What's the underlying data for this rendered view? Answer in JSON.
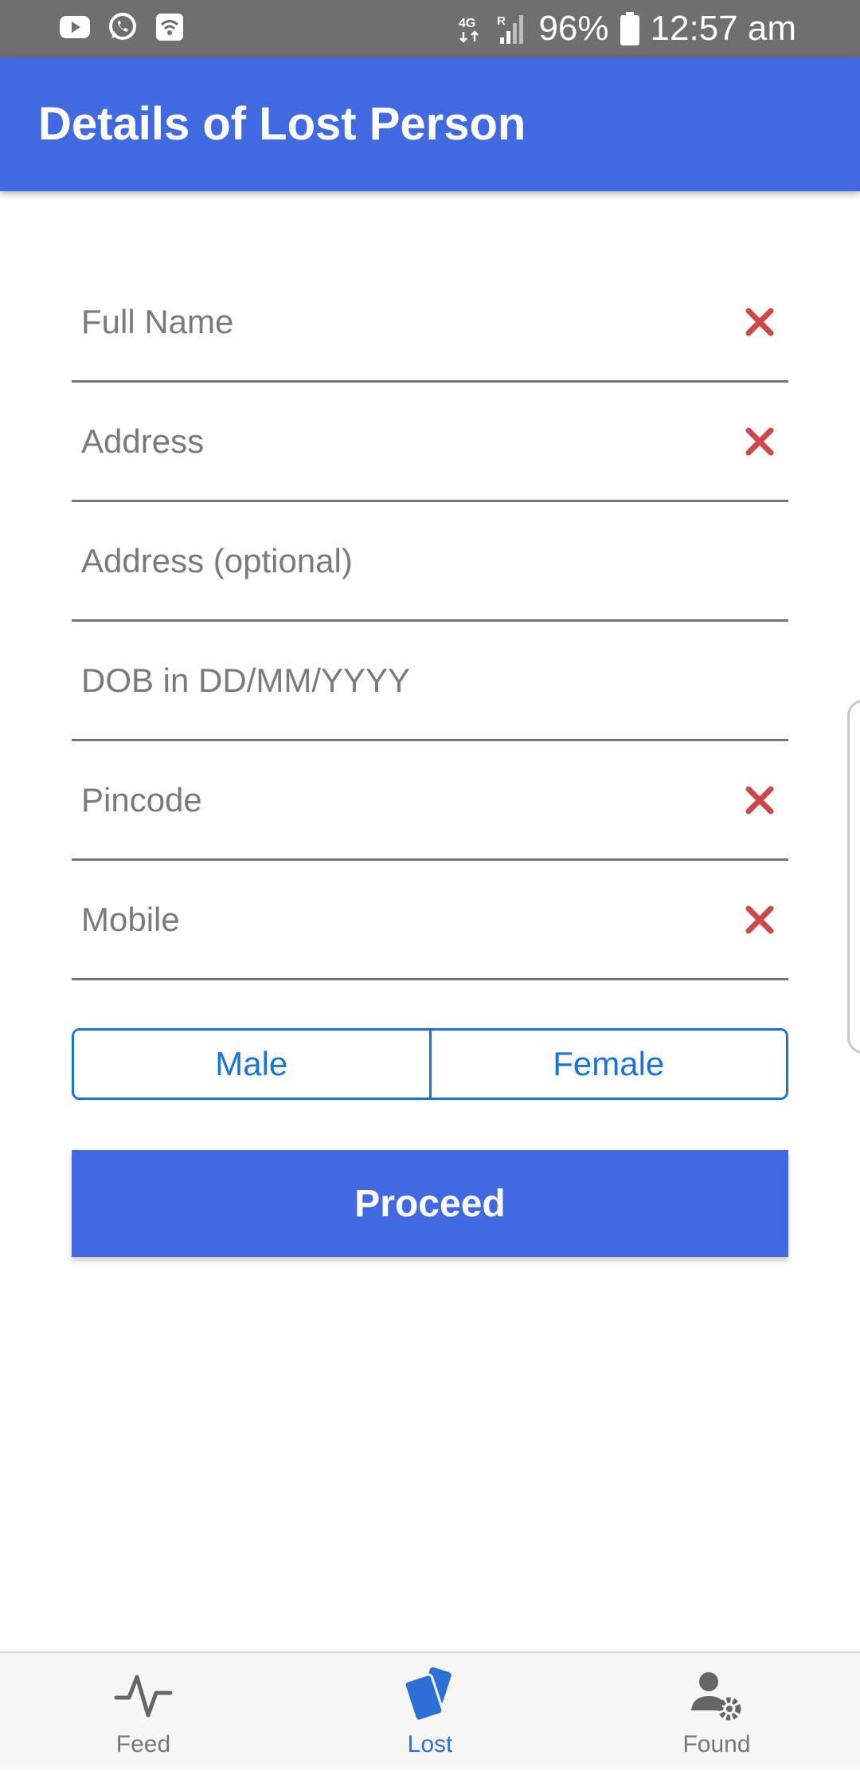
{
  "status_bar": {
    "battery_percent": "96%",
    "time": "12:57 am",
    "network": "4G",
    "roaming": "R",
    "left_icons": [
      "youtube-icon",
      "whatsapp-icon",
      "wifi-calling-icon"
    ]
  },
  "app_bar": {
    "title": "Details of Lost Person"
  },
  "form": {
    "fields": [
      {
        "placeholder": "Full Name",
        "value": "",
        "has_error": true
      },
      {
        "placeholder": "Address",
        "value": "",
        "has_error": true
      },
      {
        "placeholder": "Address (optional)",
        "value": "",
        "has_error": false
      },
      {
        "placeholder": "DOB in DD/MM/YYYY",
        "value": "",
        "has_error": false
      },
      {
        "placeholder": "Pincode",
        "value": "",
        "has_error": true
      },
      {
        "placeholder": "Mobile",
        "value": "",
        "has_error": true
      }
    ],
    "gender": {
      "options": [
        "Male",
        "Female"
      ]
    },
    "proceed_label": "Proceed"
  },
  "bottom_nav": {
    "items": [
      {
        "label": "Feed",
        "icon": "activity-pulse-icon",
        "active": false
      },
      {
        "label": "Lost",
        "icon": "cards-icon",
        "active": true
      },
      {
        "label": "Found",
        "icon": "user-settings-icon",
        "active": false
      }
    ]
  },
  "colors": {
    "primary": "#4169e1",
    "segment_accent": "#1a73d9",
    "error": "#d0474a",
    "status_bar": "#6f6f6f"
  }
}
